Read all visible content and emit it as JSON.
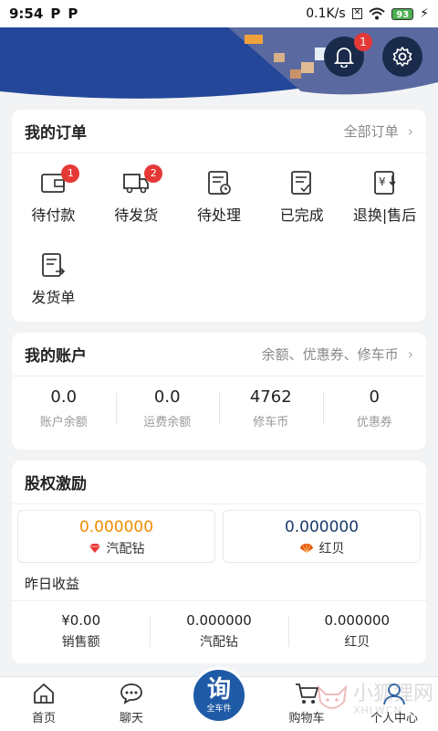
{
  "status": {
    "time": "9:54",
    "p1": "P",
    "p2": "P",
    "speed": "0.1K/s",
    "battery": "93"
  },
  "header": {
    "bell_badge": "1"
  },
  "orders": {
    "title": "我的订单",
    "link": "全部订单",
    "items": [
      {
        "label": "待付款",
        "badge": "1"
      },
      {
        "label": "待发货",
        "badge": "2"
      },
      {
        "label": "待处理"
      },
      {
        "label": "已完成"
      },
      {
        "label": "退换|售后"
      },
      {
        "label": "发货单"
      }
    ]
  },
  "account": {
    "title": "我的账户",
    "link": "余额、优惠券、修车币",
    "cells": [
      {
        "value": "0.0",
        "label": "账户余额"
      },
      {
        "value": "0.0",
        "label": "运费余额"
      },
      {
        "value": "4762",
        "label": "修车币"
      },
      {
        "value": "0",
        "label": "优惠券"
      }
    ]
  },
  "equity": {
    "title": "股权激励",
    "boxes": [
      {
        "value": "0.000000",
        "label": "汽配钻",
        "color": "#f08c00"
      },
      {
        "value": "0.000000",
        "label": "红贝",
        "color": "#1a3a6a"
      }
    ],
    "yesterday_label": "昨日收益",
    "earnings": [
      {
        "value": "¥0.00",
        "label": "销售额"
      },
      {
        "value": "0.000000",
        "label": "汽配钻"
      },
      {
        "value": "0.000000",
        "label": "红贝"
      }
    ]
  },
  "tabbar": {
    "tabs": [
      "首页",
      "聊天",
      "",
      "购物车",
      "个人中心"
    ],
    "center_big": "询",
    "center_small": "全车件"
  },
  "watermark": {
    "text": "小狐狸网",
    "sub": "XHLWCN"
  }
}
